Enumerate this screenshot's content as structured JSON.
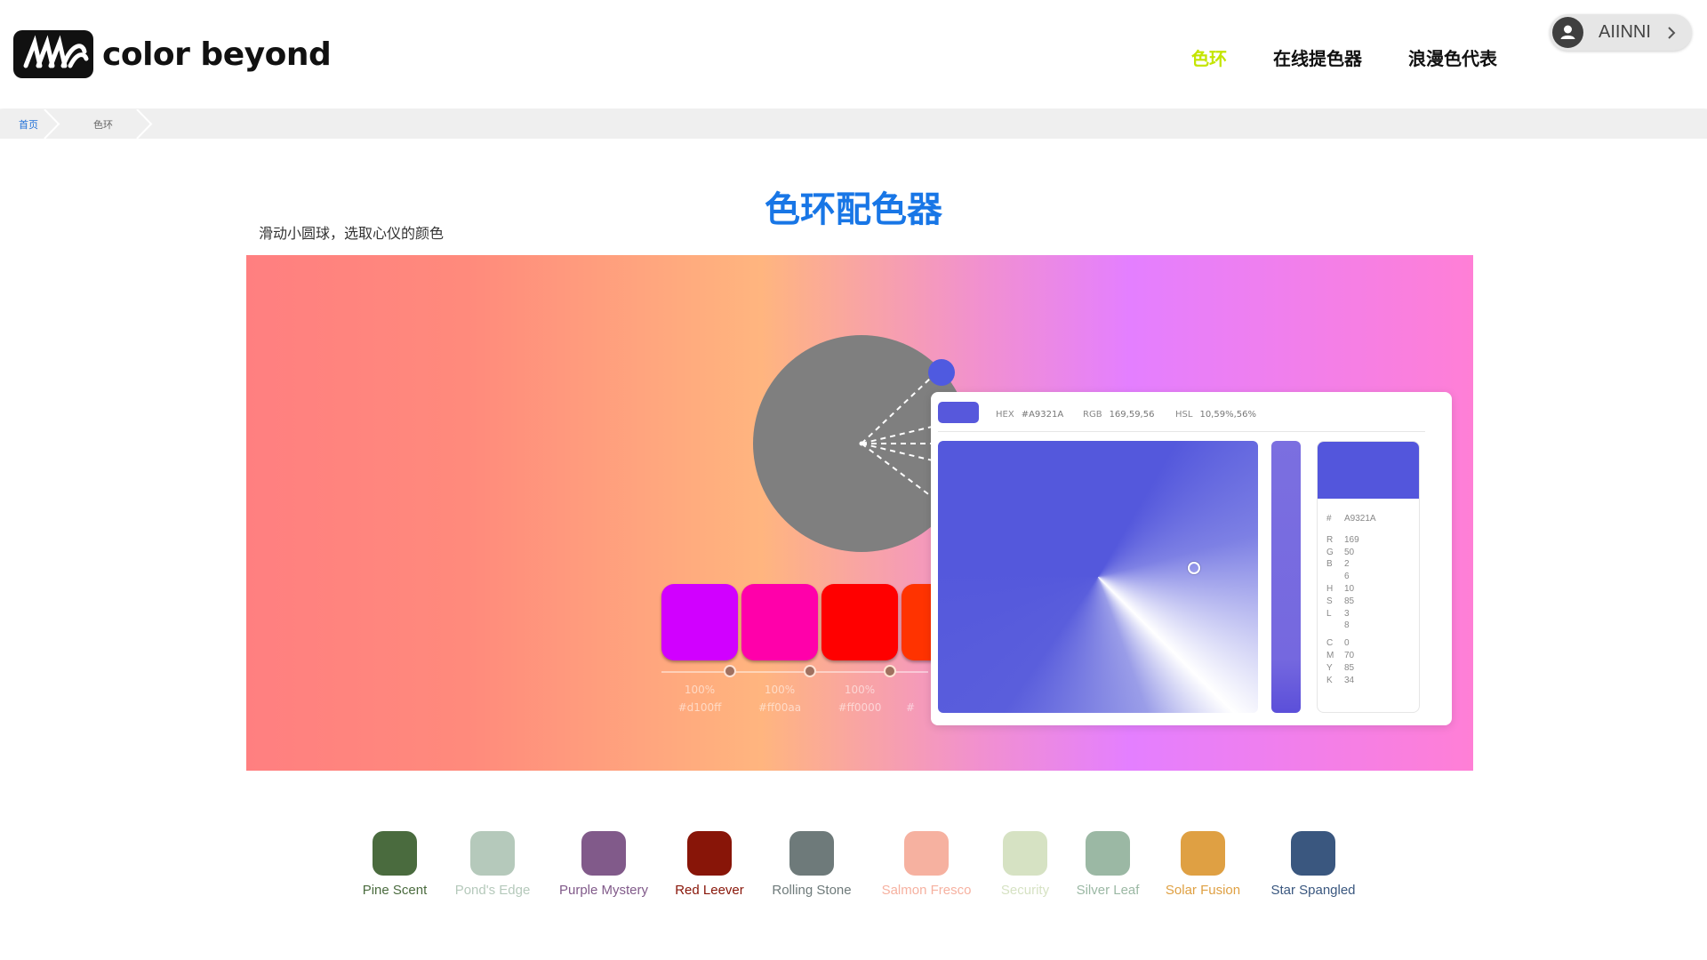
{
  "brand": {
    "name": "color beyond"
  },
  "nav": {
    "items": [
      "色环",
      "在线提色器",
      "浪漫色代表"
    ]
  },
  "user": {
    "name": "AIINNI"
  },
  "breadcrumb": {
    "home": "首页",
    "current": "色环"
  },
  "page": {
    "title": "色环配色器",
    "subtitle": "滑动小圆球，选取心仪的颜色"
  },
  "swatches": [
    {
      "color": "#d100ff",
      "pct": "100%",
      "hex": "#d100ff"
    },
    {
      "color": "#ff00aa",
      "pct": "100%",
      "hex": "#ff00aa"
    },
    {
      "color": "#ff0000",
      "pct": "100%",
      "hex": "#ff0000"
    },
    {
      "color": "#ff3300",
      "pct": "",
      "hex": "#"
    }
  ],
  "picker": {
    "hex_label": "HEX",
    "hex_value": "#A9321A",
    "rgb_label": "RGB",
    "rgb_value": "169,59,56",
    "hsl_label": "HSL",
    "hsl_value": "10,59%,56%",
    "detail": {
      "hash": "#",
      "hex": "A9321A",
      "rgb": [
        [
          "R",
          "169"
        ],
        [
          "G",
          "50"
        ],
        [
          "B",
          "2"
        ],
        [
          "",
          "6"
        ]
      ],
      "hsl": [
        [
          "H",
          "10"
        ],
        [
          "S",
          "85"
        ],
        [
          "L",
          "3"
        ],
        [
          "",
          "8"
        ]
      ],
      "cmyk": [
        [
          "C",
          "0"
        ],
        [
          "M",
          "70"
        ],
        [
          "Y",
          "85"
        ],
        [
          "K",
          "34"
        ]
      ]
    }
  },
  "palette": [
    {
      "name": "Pine Scent",
      "color": "#4a6b3e",
      "text": "#4a6b3e"
    },
    {
      "name": "Pond's Edge",
      "color": "#b5c9bb",
      "text": "#b5c9bb"
    },
    {
      "name": "Purple Mystery",
      "color": "#815a8a",
      "text": "#815a8a"
    },
    {
      "name": "Red Leever",
      "color": "#881508",
      "text": "#881508"
    },
    {
      "name": "Rolling Stone",
      "color": "#6e7a7a",
      "text": "#6e7a7a"
    },
    {
      "name": "Salmon Fresco",
      "color": "#f6b1a0",
      "text": "#f6b1a0"
    },
    {
      "name": "Security",
      "color": "#d6e2c3",
      "text": "#d6e2c3"
    },
    {
      "name": "Silver Leaf",
      "color": "#9bb8a4",
      "text": "#9bb8a4"
    },
    {
      "name": "Solar Fusion",
      "color": "#dfa043",
      "text": "#dfa043"
    },
    {
      "name": "Star Spangled",
      "color": "#3a577f",
      "text": "#3a577f"
    }
  ]
}
